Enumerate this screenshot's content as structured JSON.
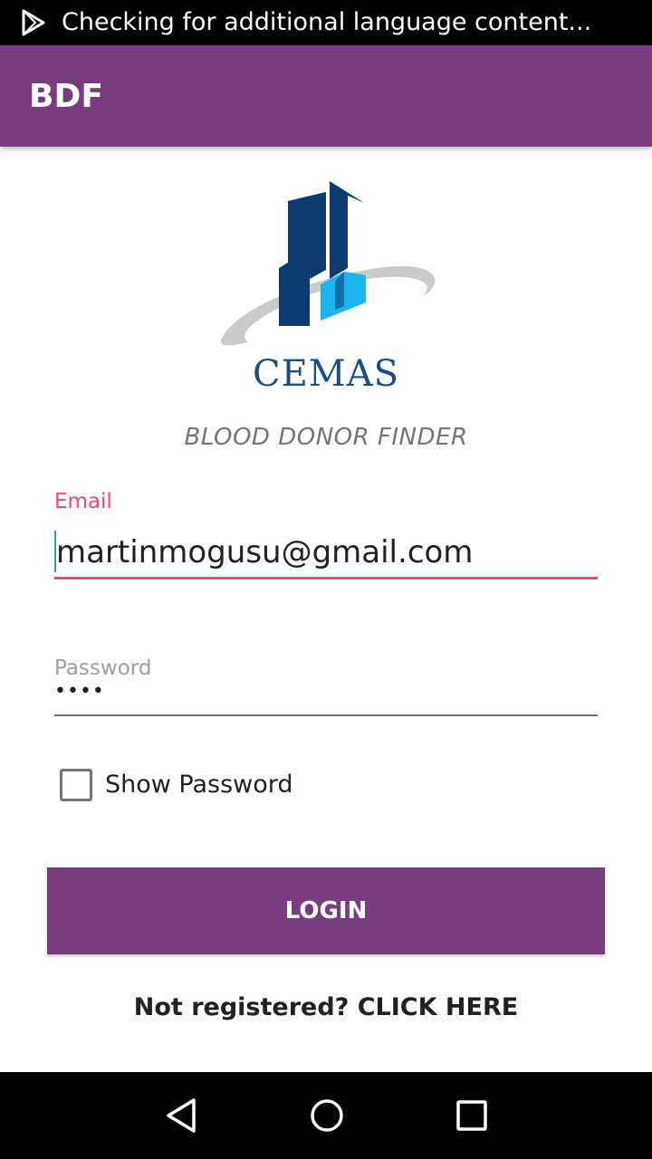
{
  "status_bar": {
    "notification_icon": "play-store-icon",
    "text": "Checking for additional language content..."
  },
  "app_bar": {
    "title": "BDF"
  },
  "logo": {
    "brand_text": "CEMAS",
    "colors": {
      "dark_blue": "#0f3a6e",
      "light_blue": "#19b6ee",
      "ring_gray": "#c9cbcd"
    }
  },
  "subtitle": "BLOOD DONOR FINDER",
  "form": {
    "email_label": "Email",
    "email_value": "martinmogusu@gmail.com",
    "password_label": "Password",
    "password_mask": "••••",
    "show_password_label": "Show Password",
    "show_password_checked": false,
    "login_label": "LOGIN",
    "register_text": "Not registered? CLICK HERE"
  },
  "nav_bar": {
    "back_icon": "back-triangle-icon",
    "home_icon": "home-circle-icon",
    "recents_icon": "recents-square-icon"
  },
  "colors": {
    "primary": "#773d7f",
    "accent": "#e84a7f",
    "cursor": "#26a69a"
  }
}
